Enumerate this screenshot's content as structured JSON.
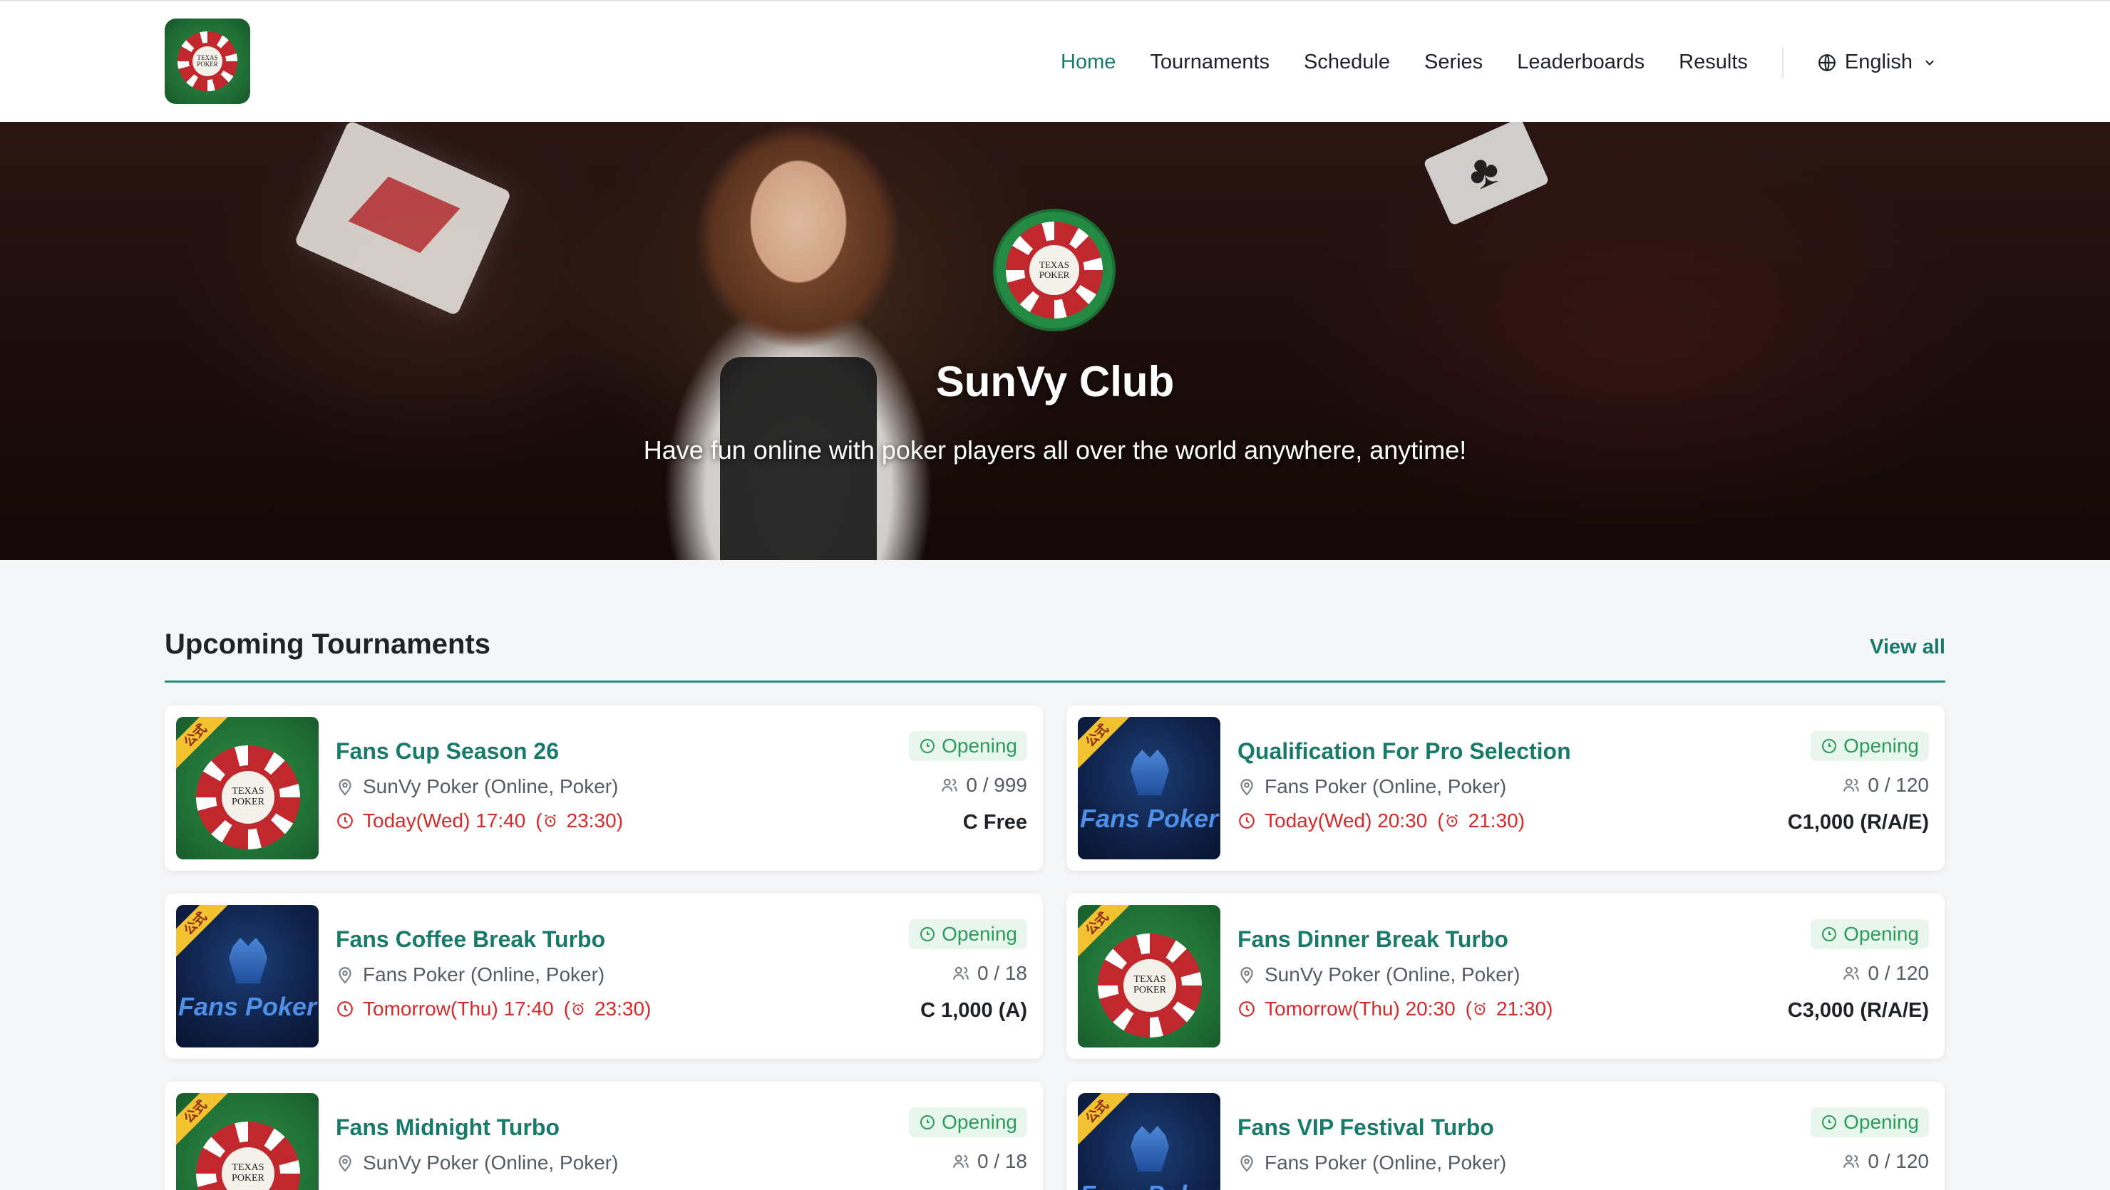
{
  "nav": {
    "logo_line1": "TEXAS",
    "logo_line2": "POKER",
    "items": [
      "Home",
      "Tournaments",
      "Schedule",
      "Series",
      "Leaderboards",
      "Results"
    ],
    "active": "Home",
    "language": "English"
  },
  "hero": {
    "title": "SunVy Club",
    "subtitle": "Have fun online with poker players all over the world anywhere, anytime!"
  },
  "section": {
    "title": "Upcoming Tournaments",
    "view_all": "View all"
  },
  "colors": {
    "accent": "#177a6b",
    "time_red": "#d42a2a",
    "status_green": "#2d9a5a"
  },
  "tournaments": [
    {
      "name": "Fans Cup Season 26",
      "venue": "SunVy Poker (Online, Poker)",
      "time": "Today(Wed) 17:40",
      "late": "23:30",
      "status": "Opening",
      "players": "0 / 999",
      "fee": "C Free",
      "thumb": "texas",
      "badge": "公式",
      "thumb_line1": "TEXAS",
      "thumb_line2": "POKER"
    },
    {
      "name": "Qualification For Pro Selection",
      "venue": "Fans Poker (Online, Poker)",
      "time": "Today(Wed) 20:30",
      "late": "21:30",
      "status": "Opening",
      "players": "0 / 120",
      "fee": "C1,000 (R/A/E)",
      "thumb": "fans",
      "badge": "公式",
      "thumb_text": "Fans Poker"
    },
    {
      "name": "Fans Coffee Break Turbo",
      "venue": "Fans Poker (Online, Poker)",
      "time": "Tomorrow(Thu) 17:40",
      "late": "23:30",
      "status": "Opening",
      "players": "0 / 18",
      "fee": "C 1,000 (A)",
      "thumb": "fans",
      "badge": "公式",
      "thumb_text": "Fans Poker"
    },
    {
      "name": "Fans Dinner Break Turbo",
      "venue": "SunVy Poker (Online, Poker)",
      "time": "Tomorrow(Thu) 20:30",
      "late": "21:30",
      "status": "Opening",
      "players": "0 / 120",
      "fee": "C3,000 (R/A/E)",
      "thumb": "texas",
      "badge": "公式",
      "thumb_line1": "TEXAS",
      "thumb_line2": "POKER"
    },
    {
      "name": "Fans Midnight Turbo",
      "venue": "SunVy Poker (Online, Poker)",
      "time": "",
      "late": "",
      "status": "Opening",
      "players": "0 / 18",
      "fee": "",
      "thumb": "texas",
      "badge": "公式",
      "thumb_line1": "TEXAS",
      "thumb_line2": "POKER"
    },
    {
      "name": "Fans VIP Festival Turbo",
      "venue": "Fans Poker (Online, Poker)",
      "time": "",
      "late": "",
      "status": "Opening",
      "players": "0 / 120",
      "fee": "",
      "thumb": "fans",
      "badge": "公式",
      "thumb_text": "Fans Poker"
    }
  ]
}
